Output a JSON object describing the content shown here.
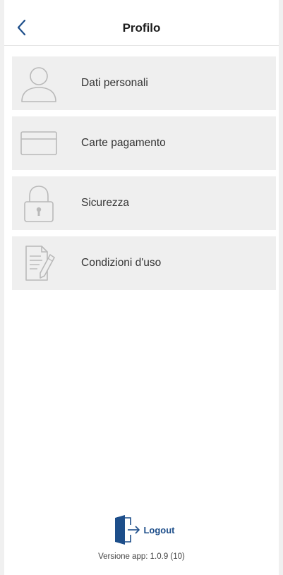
{
  "header": {
    "title": "Profilo",
    "back_icon": "chevron-left-icon"
  },
  "menu": {
    "items": [
      {
        "label": "Dati personali",
        "icon": "user-icon"
      },
      {
        "label": "Carte pagamento",
        "icon": "credit-card-icon"
      },
      {
        "label": "Sicurezza",
        "icon": "lock-icon"
      },
      {
        "label": "Condizioni d'uso",
        "icon": "document-edit-icon"
      }
    ]
  },
  "footer": {
    "logout_label": "Logout",
    "logout_icon": "door-exit-icon",
    "version_text": "Versione app: 1.0.9 (10)"
  },
  "colors": {
    "accent": "#1d4e8a",
    "item_background": "#efefef",
    "icon_stroke": "#b9b9b9"
  }
}
